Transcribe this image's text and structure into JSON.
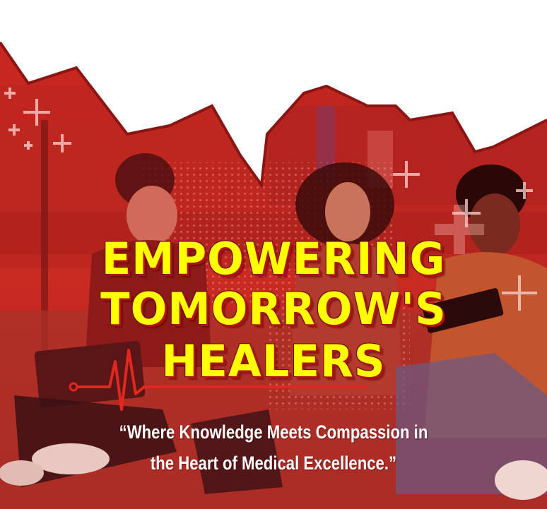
{
  "headline": {
    "line1": "EMPOWERING",
    "line2": "TOMORROW'S",
    "line3": "HEALERS"
  },
  "tagline": {
    "line1": "“Where Knowledge Meets Compassion in",
    "line2": "the Heart of Medical Excellence.”"
  },
  "colors": {
    "overlay_red": "#c4221e",
    "headline_yellow": "#ffff00",
    "quote_white": "#ffffff",
    "background_white": "#ffffff"
  },
  "icons": [
    "plus-sign-icon",
    "heartbeat-line-icon",
    "halftone-dots-pattern"
  ]
}
